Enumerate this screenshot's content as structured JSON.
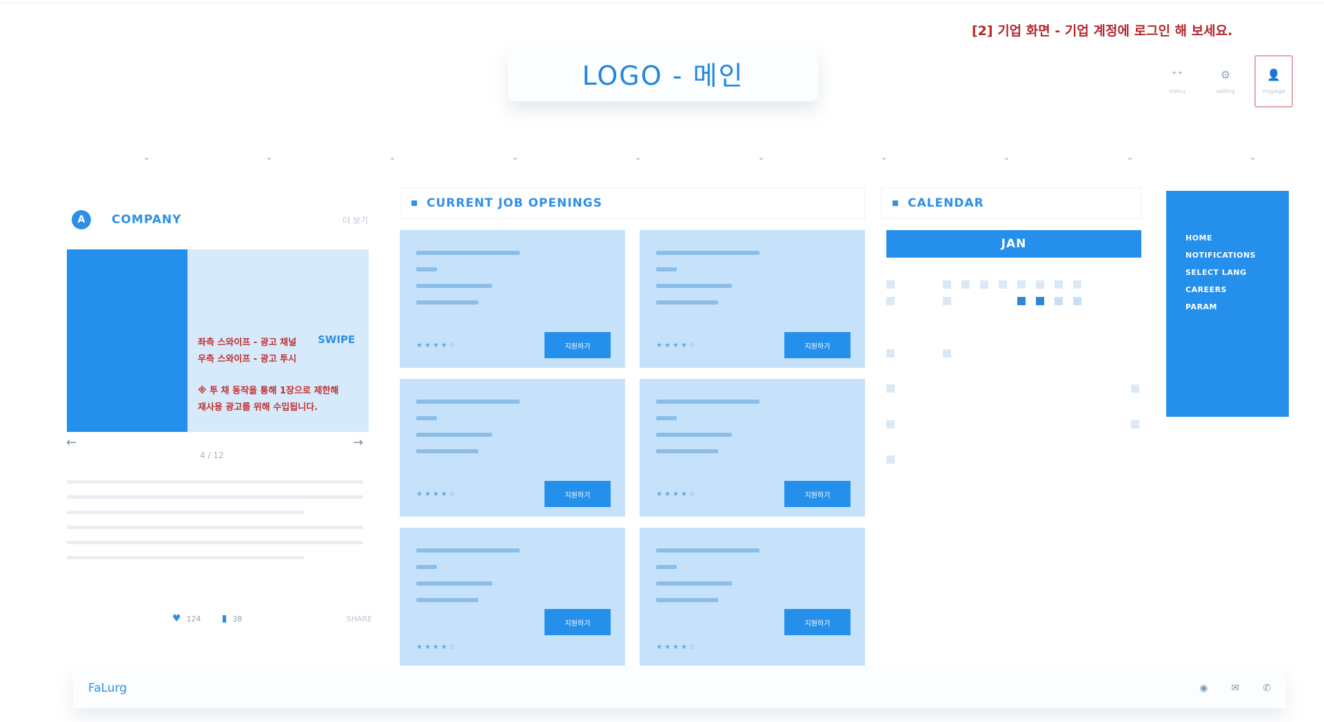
{
  "notice": "[2] 기업 화면 - 기업 계정에 로그인 해 보세요.",
  "logo": "LOGO - 메인",
  "top_icons": [
    {
      "icon": "grid-icon",
      "glyph": "⁺⁺",
      "label": "menu"
    },
    {
      "icon": "gear-icon",
      "glyph": "⚙",
      "label": "setting"
    },
    {
      "icon": "user-icon",
      "glyph": "👤",
      "label": "mypage"
    }
  ],
  "company": {
    "badge": "A",
    "title": "COMPANY",
    "more": "더 보기",
    "banner": {
      "line1": "좌측 스와이프 - 광고 채널",
      "line2": "우측 스와이프 - 광고 투시",
      "line3": "※ 투 채 동작을 통해 1장으로 제한해",
      "line4": "재사용 광고를 위해 수입됩니다.",
      "swipe": "SWIPE"
    },
    "prev": "←",
    "next": "→",
    "pager": "4 / 12",
    "stats": {
      "likes_icon": "heart-icon",
      "likes": "124",
      "saves_icon": "bookmark-icon",
      "saves": "38",
      "share": "SHARE"
    }
  },
  "jobs": {
    "title": "CURRENT JOB OPENINGS",
    "apply_label": "지원하기",
    "rating": "★★★★☆",
    "cards_count": 6
  },
  "calendar": {
    "title": "CALENDAR",
    "month": "JAN"
  },
  "side_menu": [
    "HOME",
    "NOTIFICATIONS",
    "SELECT LANG",
    "CAREERS",
    "PARAM"
  ],
  "footer": {
    "brand": "FaLurg",
    "icons": [
      {
        "icon": "location-icon",
        "glyph": "◉"
      },
      {
        "icon": "mail-icon",
        "glyph": "✉"
      },
      {
        "icon": "phone-icon",
        "glyph": "✆"
      }
    ]
  }
}
